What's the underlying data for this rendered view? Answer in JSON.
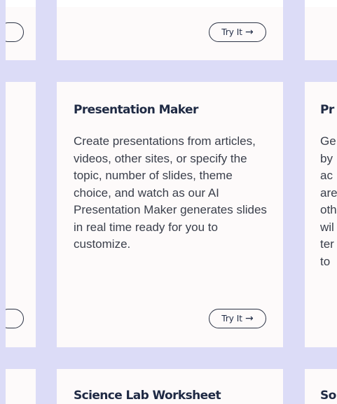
{
  "cards": {
    "top_center": {
      "button_label": "Try It",
      "button_icon": "→"
    },
    "main": {
      "title": "Presentation Maker",
      "description": "Create presentations from articles, videos, other sites, or specify the topic, number of slides, theme choice, and watch as our AI Presentation Maker generates slides in real time ready for you to customize.",
      "button_label": "Try It",
      "button_icon": "→"
    },
    "right_partial": {
      "title": "Pr",
      "lines": [
        "Ge",
        "by",
        "ac",
        "are",
        "oth",
        "wil",
        "ter",
        "to"
      ]
    },
    "bottom_center": {
      "title": "Science Lab Worksheet"
    },
    "bottom_right_partial": {
      "title": "So"
    }
  },
  "colors": {
    "gutter": "#dcdcf7",
    "card": "#fdfafa",
    "title": "#1f2a44",
    "text": "#3a3f4b"
  }
}
